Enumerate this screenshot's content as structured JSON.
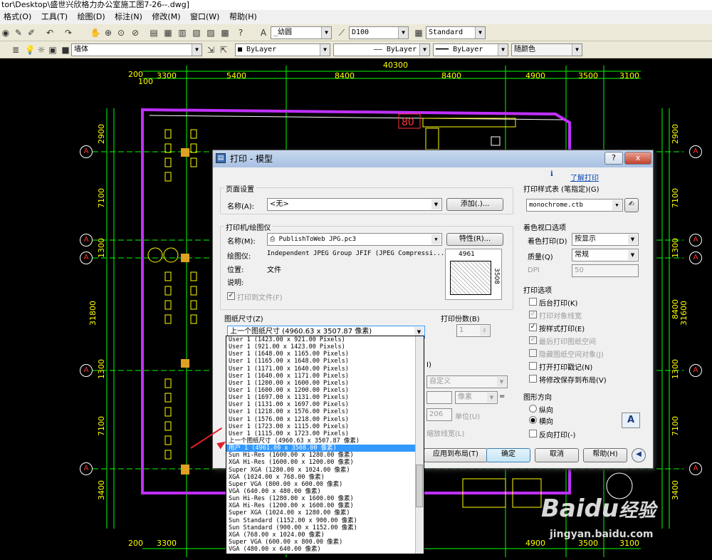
{
  "window": {
    "title": "tor\\Desktop\\盛世兴欣格力办公室施工图7-26--.dwg]"
  },
  "menu": [
    "格式(O)",
    "工具(T)",
    "绘图(D)",
    "标注(N)",
    "修改(M)",
    "窗口(W)",
    "帮助(H)"
  ],
  "toolbar1": {
    "text_style": "_幼圆",
    "dim_style": "D100",
    "table_style": "Standard"
  },
  "toolbar2": {
    "layer": "墙体",
    "color": "ByLayer",
    "linetype": "ByLayer",
    "lineweight": "ByLayer",
    "plot_style": "随颜色"
  },
  "drawing": {
    "top_dims": [
      "200",
      "3300",
      "5400",
      "8400",
      "8400",
      "4900",
      "3500",
      "3100"
    ],
    "top_total": "40300",
    "top_extra": "100",
    "bottom_dims": [
      "200",
      "3300",
      "4900",
      "3500",
      "3100"
    ],
    "left_dims": [
      "2900",
      "7100",
      "1300",
      "31800",
      "1300",
      "7100",
      "3400"
    ],
    "right_dims": [
      "2900",
      "7100",
      "1300",
      "8400",
      "31600",
      "1300",
      "7100",
      "3400"
    ],
    "axis_label": "A",
    "room_mark": "80"
  },
  "dialog": {
    "title": "打印 - 模型",
    "help_btn": "?",
    "close_btn": "x",
    "learn_link": "了解打印",
    "page_setup": {
      "group": "页面设置",
      "name_label": "名称(A):",
      "name_value": "<无>",
      "add_btn": "添加(.)..."
    },
    "printer": {
      "group": "打印机/绘图仪",
      "name_label": "名称(M):",
      "name_value": "PublishToWeb JPG.pc3",
      "props_btn": "特性(R)...",
      "plotter_label": "绘图仪:",
      "plotter_value": "Independent JPEG Group JFIF (JPEG Compressi...",
      "location_label": "位置:",
      "location_value": "文件",
      "desc_label": "说明:",
      "print_to_file": "打印到文件(F)",
      "preview_w": "4961",
      "preview_h": "3508"
    },
    "paper": {
      "group": "图纸尺寸(Z)",
      "value": "上一个图纸尺寸 (4960.63 x 3507.87 像素)"
    },
    "copies": {
      "label": "打印份数(B)",
      "value": "1"
    },
    "hidden_labels": {
      "i": "I)",
      "custom": "自定义",
      "unit_px": "像素",
      "unit": "单位(U)",
      "value_206": "206",
      "scale_lw": "缩放线宽(L)"
    },
    "style_table": {
      "group": "打印样式表 (笔指定)(G)",
      "value": "monochrome.ctb"
    },
    "shaded": {
      "group": "着色视口选项",
      "shade_label": "着色打印(D)",
      "shade_value": "按显示",
      "quality_label": "质量(Q)",
      "quality_value": "常规",
      "dpi_label": "DPI",
      "dpi_value": "50"
    },
    "options": {
      "group": "打印选项",
      "items": [
        {
          "label": "后台打印(K)",
          "checked": false,
          "disabled": false
        },
        {
          "label": "打印对象线宽",
          "checked": true,
          "disabled": true
        },
        {
          "label": "按样式打印(E)",
          "checked": true,
          "disabled": false
        },
        {
          "label": "最后打印图纸空间",
          "checked": true,
          "disabled": true
        },
        {
          "label": "隐藏图纸空间对象(J)",
          "checked": false,
          "disabled": true
        },
        {
          "label": "打开打印戳记(N)",
          "checked": false,
          "disabled": false
        },
        {
          "label": "将修改保存到布局(V)",
          "checked": false,
          "disabled": false
        }
      ]
    },
    "orientation": {
      "group": "图形方向",
      "portrait": "纵向",
      "landscape": "横向",
      "reverse": "反向打印(-)",
      "icon": "A"
    },
    "buttons": {
      "apply": "应用到布局(T)",
      "ok": "确定",
      "cancel": "取消",
      "help": "帮助(H)"
    },
    "paper_list": [
      "User 1 (1423.00 x 921.00 Pixels)",
      "User 1 (921.00 x 1423.00 Pixels)",
      "User 1 (1648.00 x 1165.00 Pixels)",
      "User 1 (1165.00 x 1648.00 Pixels)",
      "User 1 (1171.00 x 1640.00 Pixels)",
      "User 1 (1640.00 x 1171.00 Pixels)",
      "User 1 (1200.00 x 1600.00 Pixels)",
      "User 1 (1600.00 x 1200.00 Pixels)",
      "User 1 (1697.00 x 1131.00 Pixels)",
      "User 1 (1131.00 x 1697.00 Pixels)",
      "User 1 (1218.00 x 1576.00 Pixels)",
      "User 1 (1576.00 x 1218.00 Pixels)",
      "User 1 (1723.00 x 1115.00 Pixels)",
      "User 1 (1115.00 x 1723.00 Pixels)",
      "上一个图纸尺寸 (4960.63 x 3507.87 像素)",
      "用户 1 (4961.00 x 3508.00 像素)",
      "Sun Hi-Res (1600.00 x 1280.00 像素)",
      "XGA Hi-Res (1600.00 x 1200.00 像素)",
      "Super XGA (1280.00 x 1024.00 像素)",
      "XGA (1024.00 x 768.00 像素)",
      "Super VGA (800.00 x 600.00 像素)",
      "VGA (640.00 x 480.00 像素)",
      "Sun Hi-Res (1280.00 x 1600.00 像素)",
      "XGA Hi-Res (1200.00 x 1600.00 像素)",
      "Super XGA (1024.00 x 1280.00 像素)",
      "Sun Standard (1152.00 x 900.00 像素)",
      "Sun Standard (900.00 x 1152.00 像素)",
      "XGA (768.00 x 1024.00 像素)",
      "Super VGA (600.00 x 800.00 像素)",
      "VGA (480.00 x 640.00 像素)"
    ],
    "highlighted_index": 15
  },
  "watermark": {
    "brand": "Baidu",
    "brand_cn": "经验",
    "url": "jingyan.baidu.com"
  }
}
